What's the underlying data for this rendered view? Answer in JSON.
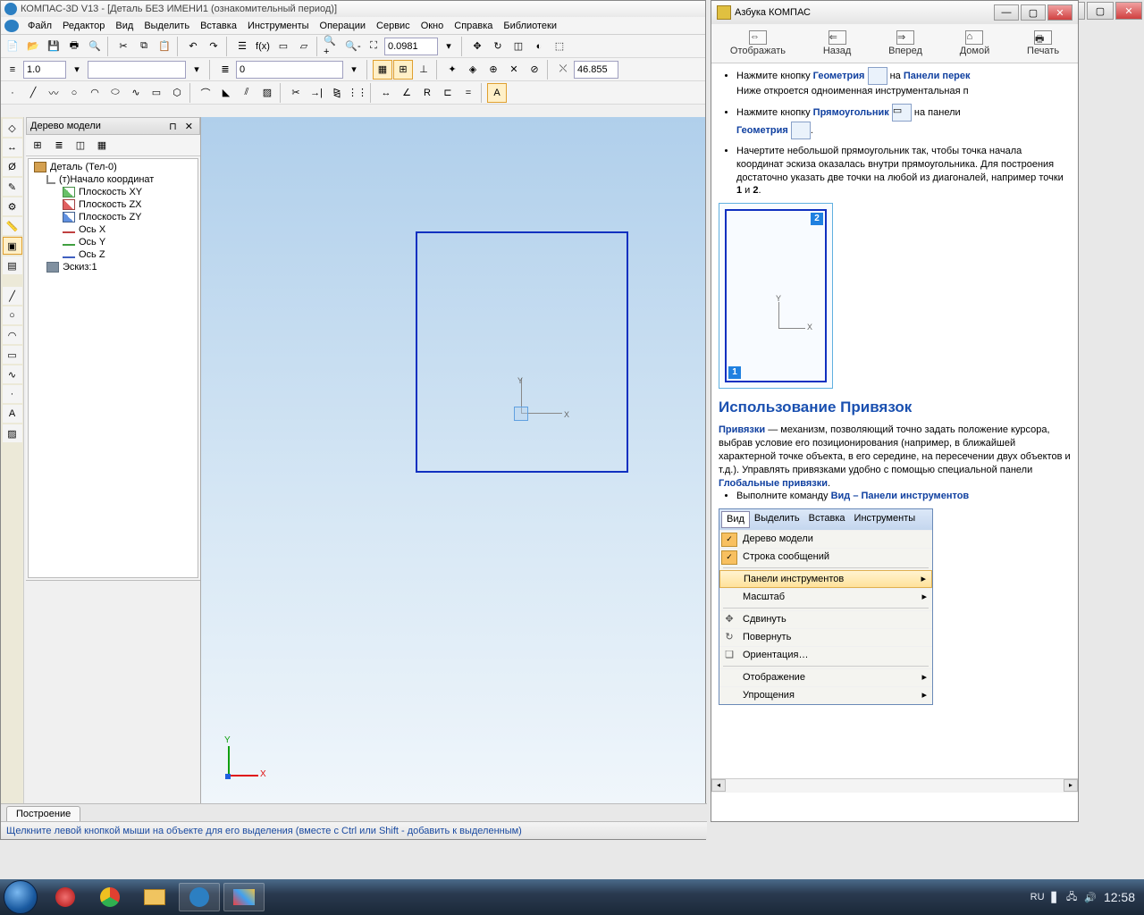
{
  "app": {
    "title": "КОМПАС-3D V13 - [Деталь БЕЗ ИМЕНИ1 (ознакомительный период)]",
    "menu": [
      "Файл",
      "Редактор",
      "Вид",
      "Выделить",
      "Вставка",
      "Инструменты",
      "Операции",
      "Сервис",
      "Окно",
      "Справка",
      "Библиотеки"
    ]
  },
  "toolbars": {
    "zoom_value": "0.0981",
    "coord_value": "46.855",
    "style_value": "1.0",
    "layer_value": "0"
  },
  "tree": {
    "title": "Дерево модели",
    "items": [
      {
        "lvl": 0,
        "icon": "ti-detail",
        "label": "Деталь (Тел-0)"
      },
      {
        "lvl": 1,
        "icon": "ti-origin",
        "label": "(т)Начало координат"
      },
      {
        "lvl": 2,
        "icon": "ti-plane-xy",
        "label": "Плоскость XY"
      },
      {
        "lvl": 2,
        "icon": "ti-plane-zx",
        "label": "Плоскость ZX"
      },
      {
        "lvl": 2,
        "icon": "ti-plane-zy",
        "label": "Плоскость ZY"
      },
      {
        "lvl": 2,
        "icon": "ti-ax",
        "label": "Ось X"
      },
      {
        "lvl": 2,
        "icon": "ti-ay",
        "label": "Ось Y"
      },
      {
        "lvl": 2,
        "icon": "ti-az",
        "label": "Ось Z"
      },
      {
        "lvl": 1,
        "icon": "ti-sketch",
        "label": "Эскиз:1"
      }
    ]
  },
  "canvas": {
    "axis_x": "X",
    "axis_y": "Y"
  },
  "tab": {
    "label": "Построение"
  },
  "status": {
    "text": "Щелкните левой кнопкой мыши на объекте для его выделения (вместе с Ctrl или Shift - добавить к выделенным)"
  },
  "help": {
    "title": "Азбука КОМПАС",
    "nav": [
      "Отображать",
      "Назад",
      "Вперед",
      "Домой",
      "Печать"
    ],
    "li1_a": "Нажмите кнопку ",
    "li1_b": "Геометрия",
    "li1_c": " на ",
    "li1_d": "Панели перек",
    "li1_e": "Ниже откроется одноименная инструментальная п",
    "li2_a": "Нажмите кнопку ",
    "li2_b": "Прямоугольник",
    "li2_c": " на панели ",
    "li2_d": "Геометрия",
    "li3_a": "Начертите небольшой прямоугольник так, чтобы точка начала координат эскиза оказалась внутри прямоугольника. Для построения достаточно указать две точки на любой из диагоналей, например точки ",
    "li3_b": "1",
    "li3_c": " и ",
    "li3_d": "2",
    "li3_e": ".",
    "h": "Использование Привязок",
    "p_a": "Привязки",
    "p_b": " — механизм, позволяющий точно задать положение курсора, выбрав условие его позиционирования (например, в ближайшей характерной точке объекта, в его середине, на пересечении двух объектов и т.д.). Управлять привязками удобно с помощью специальной панели ",
    "p_c": "Глобальные привязки",
    "p_d": ".",
    "li4_a": "Выполните команду ",
    "li4_b": "Вид – Панели инструментов",
    "menu_tabs": [
      "Вид",
      "Выделить",
      "Вставка",
      "Инструменты"
    ],
    "menu_items": [
      {
        "chk": true,
        "label": "Дерево модели"
      },
      {
        "chk": true,
        "label": "Строка сообщений"
      },
      {
        "hl": true,
        "label": "Панели инструментов",
        "arrow": true
      },
      {
        "label": "Масштаб",
        "arrow": true
      },
      {
        "icon": "✥",
        "label": "Сдвинуть"
      },
      {
        "icon": "↻",
        "label": "Повернуть"
      },
      {
        "icon": "❏",
        "label": "Ориентация…"
      },
      {
        "label": "Отображение",
        "arrow": true
      },
      {
        "label": "Упрощения",
        "arrow": true
      }
    ],
    "diagram": {
      "p1": "1",
      "p2": "2",
      "y": "Y",
      "x": "X"
    }
  },
  "taskbar": {
    "lang": "RU",
    "time": "12:58"
  }
}
